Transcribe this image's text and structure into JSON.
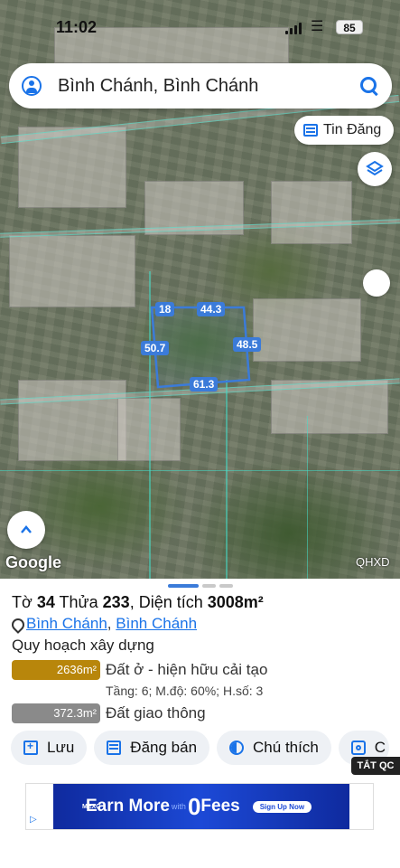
{
  "status_bar": {
    "time": "11:02",
    "battery": "85"
  },
  "search": {
    "text": "Bình Chánh, Bình Chánh"
  },
  "map": {
    "tin_dang_label": "Tin Đăng",
    "google_logo": "Google",
    "overlay_label": "QHXD",
    "dimensions": [
      "18",
      "44.3",
      "50.7",
      "48.5",
      "61.3"
    ]
  },
  "sheet": {
    "title_prefix": "Tờ",
    "title_sheet_no": "34",
    "title_plot_word": "Thửa",
    "title_plot_no": "233",
    "title_area_word": ", Diện tích",
    "title_area_value": "3008m²",
    "location_district": "Bình Chánh",
    "location_separator": ",",
    "location_city": "Bình Chánh",
    "planning_heading": "Quy hoạch xây dựng",
    "zones": [
      {
        "area": "2636m²",
        "label": "Đất ở - hiện hữu cải tạo",
        "color": "#b8860b"
      },
      {
        "area": "372.3m²",
        "label": "Đất giao thông",
        "color": "#8a8a8a"
      }
    ],
    "zone1_details": "Tầng: 6; M.độ: 60%; H.số: 3",
    "actions": {
      "save": "Lưu",
      "post": "Đăng bán",
      "legend": "Chú thích",
      "capture": "C"
    },
    "hide_ad": "TẮT QC"
  },
  "ad": {
    "brand": "MEXC",
    "text_earn": "Earn More",
    "text_with": "with",
    "text_zero": "0",
    "text_fees": "Fees",
    "cta": "Sign Up Now"
  }
}
